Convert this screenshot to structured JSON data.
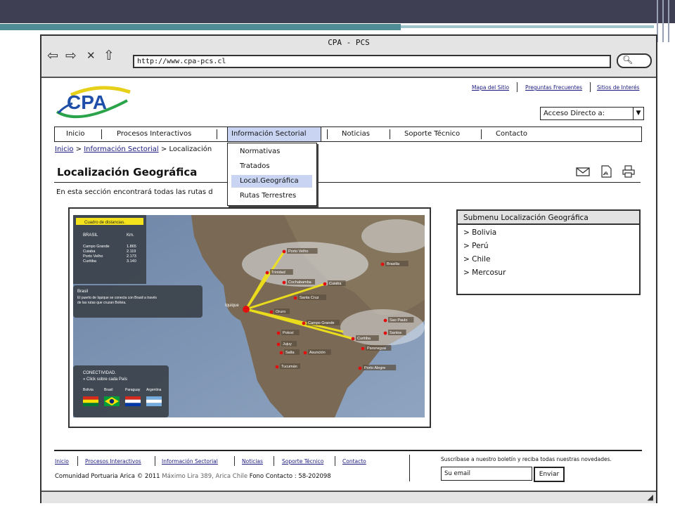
{
  "window": {
    "title": "CPA - PCS",
    "url": "http://www.cpa-pcs.cl"
  },
  "nav_icons": [
    "back-arrow-icon",
    "forward-arrow-icon",
    "close-icon",
    "home-icon"
  ],
  "logo": {
    "text": "CPA",
    "colors": [
      "#1f4fa8",
      "#e6d01a",
      "#2aa34a"
    ]
  },
  "top_links": [
    "Mapa del Sitio",
    "Preguntas Frecuentes",
    "Sitios de Interés"
  ],
  "acceso_directo": {
    "label": "Acceso Directo a:"
  },
  "menu": [
    "Inicio",
    "Procesos Interactivos",
    "Información Sectorial",
    "Noticias",
    "Soporte Técnico",
    "Contacto"
  ],
  "dropdown": [
    {
      "label": "Normativas",
      "selected": false
    },
    {
      "label": "Tratados",
      "selected": false
    },
    {
      "label": "Local.Geográfica",
      "selected": true
    },
    {
      "label": "Rutas Terrestres",
      "selected": false
    }
  ],
  "breadcrumb": {
    "home": "Inicio",
    "section": "Información Sectorial",
    "current": "Localización"
  },
  "page_title": "Localización Geográfica",
  "intro": "En esta sección encontrará todas las rutas d",
  "title_icons": [
    "email-icon",
    "pdf-icon",
    "print-icon"
  ],
  "map": {
    "distances_title": "Cuadro de distancias.",
    "col_country": "BRASIL",
    "col_km": "Km.",
    "rows": [
      {
        "city": "Campo Grande",
        "km": "1.865"
      },
      {
        "city": "Cuiaba",
        "km": "2.119"
      },
      {
        "city": "Porto Velho",
        "km": "2.173"
      },
      {
        "city": "Curitiba",
        "km": "3.140"
      }
    ],
    "info_title": "Brasil",
    "info_text": "El puerto de Iquique se conecta con Brasil a través de las rutas que cruzan Bolivia.",
    "conn_title": "CONECTIVIDAD.",
    "conn_sub": "» Click sobre cada País",
    "flags": [
      {
        "name": "Bolivia",
        "colors": [
          "#d52b1e",
          "#f9e300",
          "#007934"
        ]
      },
      {
        "name": "Brasil",
        "colors": [
          "#009c3b",
          "#ffdf00",
          "#002776"
        ]
      },
      {
        "name": "Paraguay",
        "colors": [
          "#d52b1e",
          "#ffffff",
          "#0038a8"
        ]
      },
      {
        "name": "Argentina",
        "colors": [
          "#74acdf",
          "#ffffff",
          "#74acdf"
        ]
      }
    ],
    "origin": "Iquique",
    "cities": [
      "Porto Velho",
      "Brasilia",
      "Trinidad",
      "Cochabamba",
      "Cuiaba",
      "Santa Cruz",
      "Oruro",
      "Campo Grande",
      "Sao Paulo",
      "Santos",
      "Potosí",
      "Curitiba",
      "Jujuy",
      "Paranagua",
      "Salta",
      "Asunción",
      "Tucumán",
      "Porto Alegre"
    ]
  },
  "submenu": {
    "title": "Submenu Localización Geográfica",
    "items": [
      "Bolivia",
      "Perú",
      "Chile",
      "Mercosur"
    ]
  },
  "footer": {
    "links": [
      "Inicio",
      "Procesos Interactivos",
      "Información Sectorial",
      "Noticias",
      "Soporte Técnico",
      "Contacto"
    ],
    "copyright": "Comunidad Portuaria Arica © 2011",
    "address": "Máximo Lira 389, Arica Chile",
    "phone": "Fono Contacto : 58-202098",
    "subscribe_text": "Suscríbase a nuestro boletín y reciba todas nuestras novedades.",
    "email_value": "Su email",
    "send_label": "Enviar"
  }
}
